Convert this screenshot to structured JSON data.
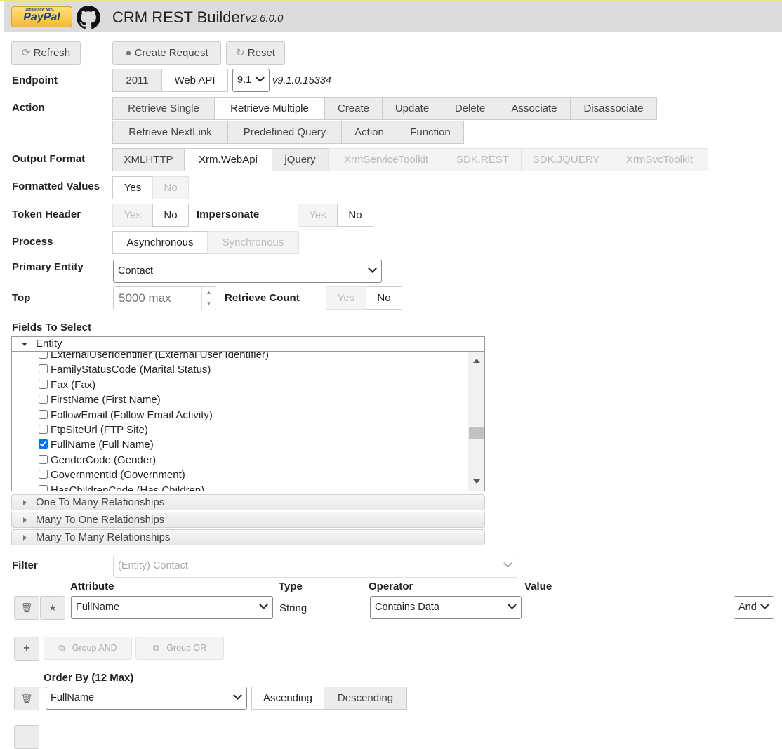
{
  "header": {
    "paypal": "PayPal",
    "paypal_small": "Donate now with...",
    "title": "CRM REST Builder",
    "version": "v2.6.0.0"
  },
  "toolbar": {
    "refresh": "Refresh",
    "create": "Create Request",
    "reset": "Reset"
  },
  "endpoint": {
    "label": "Endpoint",
    "options": [
      "2011",
      "Web API"
    ],
    "selected": "Web API",
    "version_select": "9.1",
    "version_text": "v9.1.0.15334"
  },
  "action": {
    "label": "Action",
    "row1": [
      "Retrieve Single",
      "Retrieve Multiple",
      "Create",
      "Update",
      "Delete",
      "Associate",
      "Disassociate"
    ],
    "row2": [
      "Retrieve NextLink",
      "Predefined Query",
      "Action",
      "Function"
    ],
    "selected": "Retrieve Multiple"
  },
  "output": {
    "label": "Output Format",
    "options": [
      "XMLHTTP",
      "Xrm.WebApi",
      "jQuery",
      "XrmServiceToolkit",
      "SDK.REST",
      "SDK.JQUERY",
      "XrmSvcToolkit"
    ],
    "selected": "Xrm.WebApi"
  },
  "formatted": {
    "label": "Formatted Values",
    "yes": "Yes",
    "no": "No",
    "selected": "Yes"
  },
  "token": {
    "label": "Token Header",
    "yes": "Yes",
    "no": "No",
    "selected": "No"
  },
  "impersonate": {
    "label": "Impersonate",
    "yes": "Yes",
    "no": "No",
    "selected": "No"
  },
  "process": {
    "label": "Process",
    "async": "Asynchronous",
    "sync": "Synchronous",
    "selected": "Asynchronous"
  },
  "primary": {
    "label": "Primary Entity",
    "value": "Contact"
  },
  "top": {
    "label": "Top",
    "placeholder": "5000 max"
  },
  "count": {
    "label": "Retrieve Count",
    "yes": "Yes",
    "no": "No",
    "selected": "No"
  },
  "fields": {
    "label": "Fields To Select",
    "entity": "Entity",
    "items": [
      {
        "text": "ExternalUserIdentifier (External User Identifier)",
        "checked": false
      },
      {
        "text": "FamilyStatusCode (Marital Status)",
        "checked": false
      },
      {
        "text": "Fax (Fax)",
        "checked": false
      },
      {
        "text": "FirstName (First Name)",
        "checked": false
      },
      {
        "text": "FollowEmail (Follow Email Activity)",
        "checked": false
      },
      {
        "text": "FtpSiteUrl (FTP Site)",
        "checked": false
      },
      {
        "text": "FullName (Full Name)",
        "checked": true
      },
      {
        "text": "GenderCode (Gender)",
        "checked": false
      },
      {
        "text": "GovernmentId (Government)",
        "checked": false
      },
      {
        "text": "HasChildrenCode (Has Children)",
        "checked": false
      }
    ],
    "relationships": [
      "One To Many Relationships",
      "Many To One Relationships",
      "Many To Many Relationships"
    ]
  },
  "filter": {
    "label": "Filter",
    "entity": "(Entity) Contact",
    "headers": {
      "attribute": "Attribute",
      "type": "Type",
      "operator": "Operator",
      "value": "Value"
    },
    "row": {
      "attribute": "FullName",
      "type": "String",
      "operator": "Contains Data",
      "logic": "And"
    },
    "group_and": "Group AND",
    "group_or": "Group OR"
  },
  "order": {
    "label": "Order By (12 Max)",
    "attribute": "FullName",
    "asc": "Ascending",
    "desc": "Descending",
    "selected": "Ascending"
  }
}
